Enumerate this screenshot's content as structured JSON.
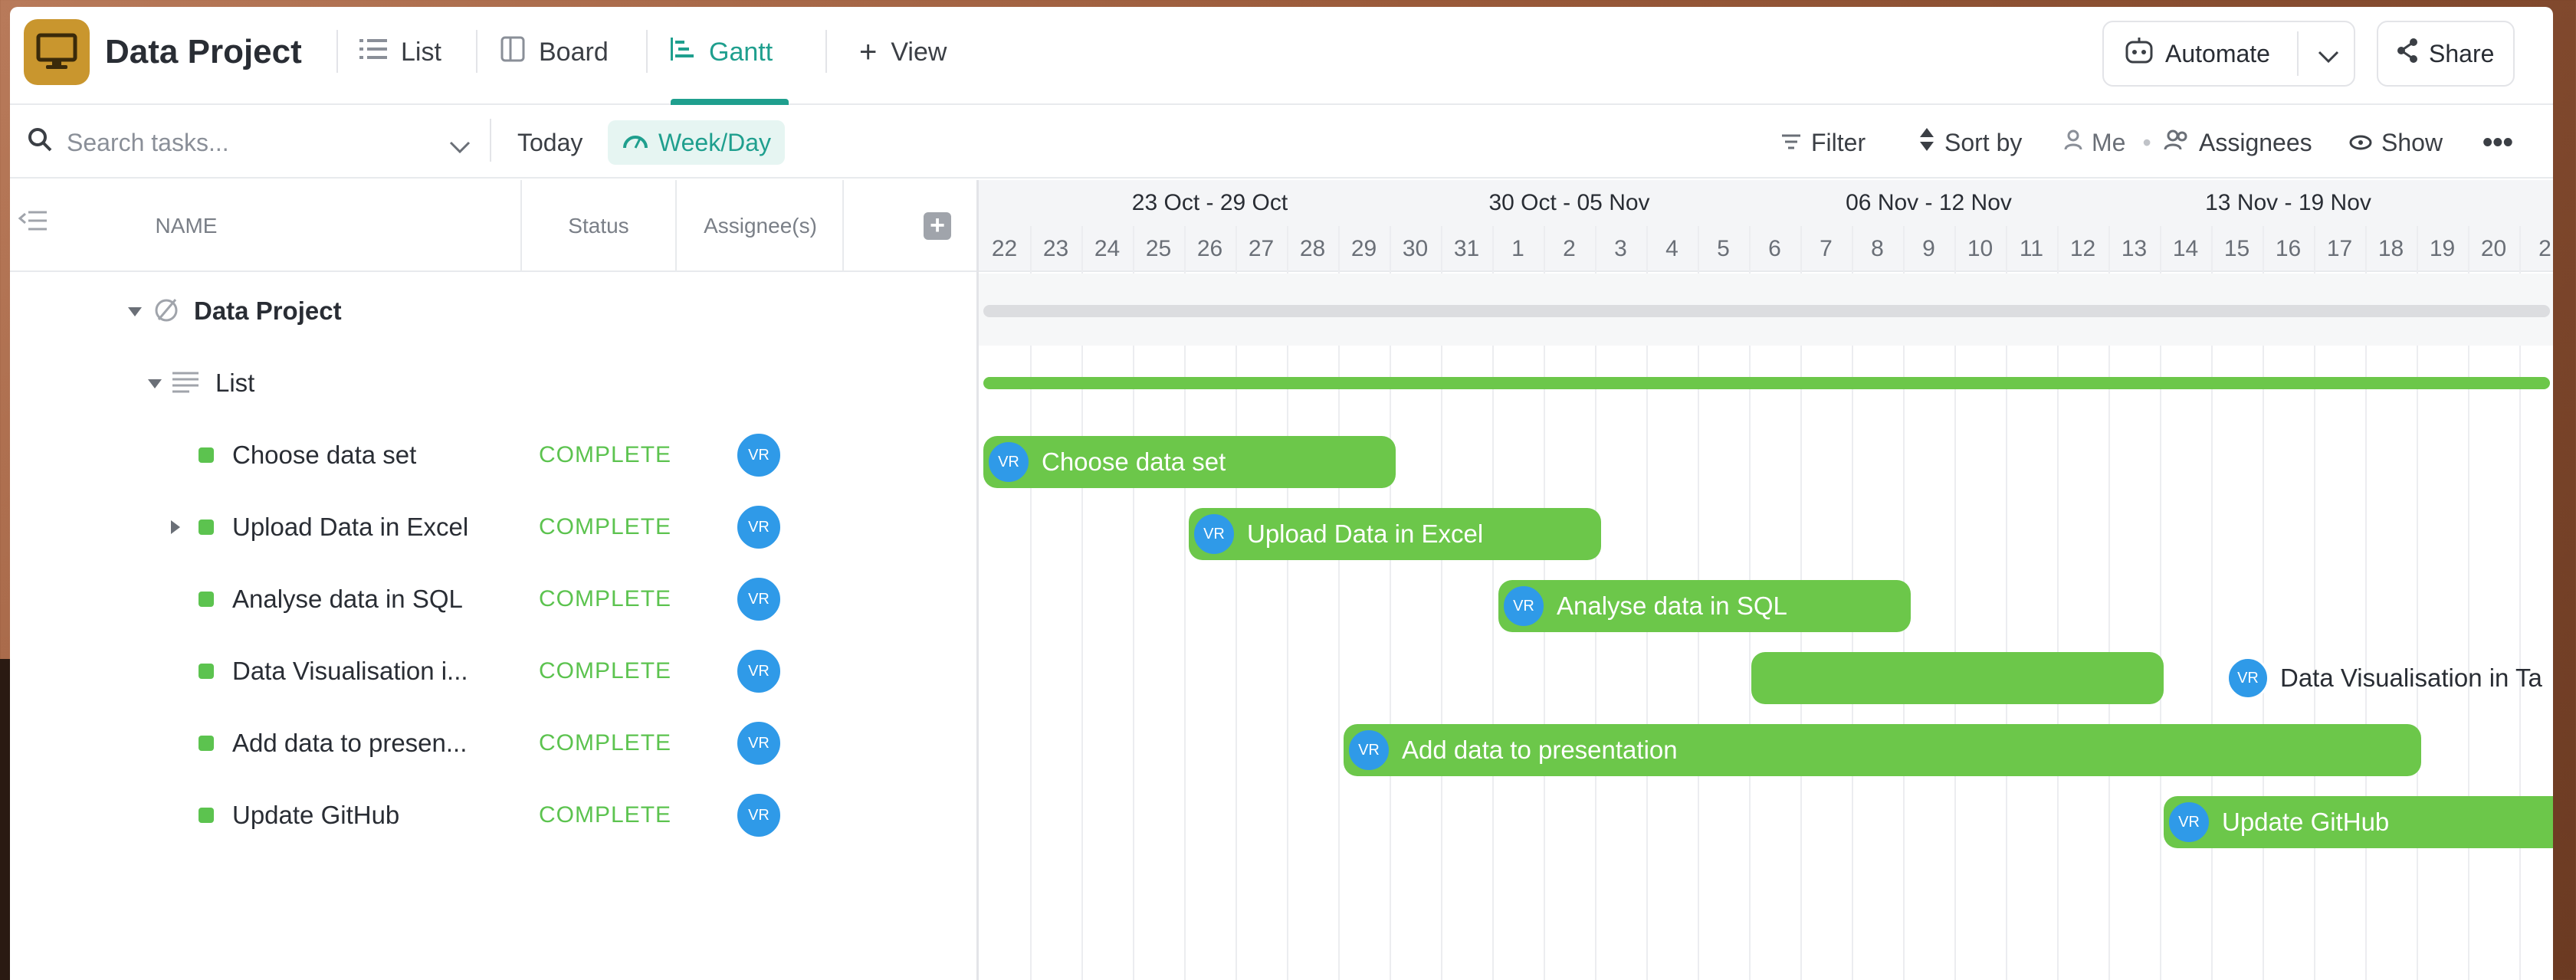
{
  "header": {
    "title": "Data Project",
    "tabs": [
      {
        "label": "List"
      },
      {
        "label": "Board"
      },
      {
        "label": "Gantt"
      }
    ],
    "add_view_label": "View",
    "automate_label": "Automate",
    "share_label": "Share"
  },
  "toolbar": {
    "search_placeholder": "Search tasks...",
    "today_label": "Today",
    "weekday_label": "Week/Day",
    "filter_label": "Filter",
    "sort_label": "Sort by",
    "me_label": "Me",
    "assignees_label": "Assignees",
    "show_label": "Show"
  },
  "table": {
    "columns": {
      "name": "NAME",
      "status": "Status",
      "assignees": "Assignee(s)"
    },
    "project_name": "Data Project",
    "list_name": "List",
    "tasks": [
      {
        "name": "Choose data set",
        "status": "COMPLETE",
        "assignee": "VR"
      },
      {
        "name": "Upload Data in Excel",
        "status": "COMPLETE",
        "assignee": "VR"
      },
      {
        "name": "Analyse data in SQL",
        "status": "COMPLETE",
        "assignee": "VR"
      },
      {
        "name": "Data Visualisation i...",
        "status": "COMPLETE",
        "assignee": "VR"
      },
      {
        "name": "Add data to presen...",
        "status": "COMPLETE",
        "assignee": "VR"
      },
      {
        "name": "Update GitHub",
        "status": "COMPLETE",
        "assignee": "VR"
      }
    ]
  },
  "gantt": {
    "weeks": [
      "23 Oct - 29 Oct",
      "30 Oct - 05 Nov",
      "06 Nov - 12 Nov",
      "13 Nov - 19 Nov"
    ],
    "days": [
      "22",
      "23",
      "24",
      "25",
      "26",
      "27",
      "28",
      "29",
      "30",
      "31",
      "1",
      "2",
      "3",
      "4",
      "5",
      "6",
      "7",
      "8",
      "9",
      "10",
      "11",
      "12",
      "13",
      "14",
      "15",
      "16",
      "17",
      "18",
      "19",
      "20",
      "2"
    ],
    "bars": [
      {
        "label": "Choose data set",
        "assignee": "VR"
      },
      {
        "label": "Upload Data in Excel",
        "assignee": "VR"
      },
      {
        "label": "Analyse data in SQL",
        "assignee": "VR"
      },
      {
        "label": "Data Visualisation in Ta",
        "assignee": "VR"
      },
      {
        "label": "Add data to presentation",
        "assignee": "VR"
      },
      {
        "label": "Update GitHub",
        "assignee": "VR"
      }
    ]
  },
  "colors": {
    "accent": "#1f9f8e",
    "complete": "#5cc34f",
    "bar": "#6cc74a",
    "avatar": "#2f9ae8"
  }
}
